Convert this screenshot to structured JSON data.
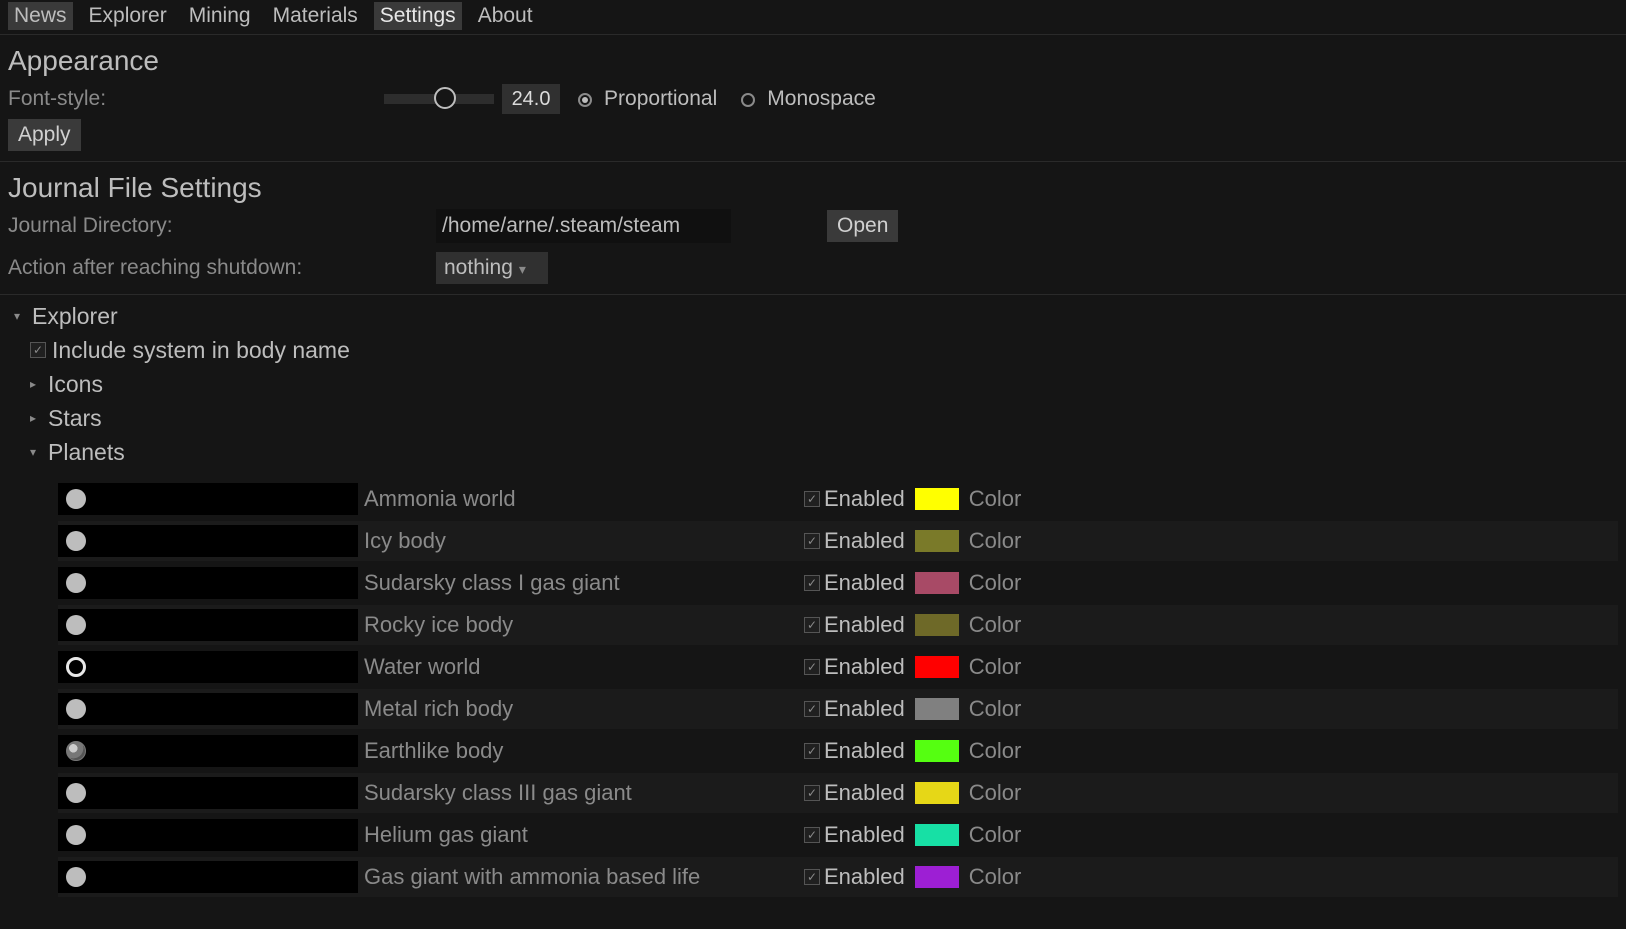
{
  "tabs": [
    "News",
    "Explorer",
    "Mining",
    "Materials",
    "Settings",
    "About"
  ],
  "active_tab": "Settings",
  "appearance": {
    "title": "Appearance",
    "font_style_label": "Font-style:",
    "font_size": "24.0",
    "prop_label": "Proportional",
    "mono_label": "Monospace",
    "apply_label": "Apply"
  },
  "journal": {
    "title": "Journal File Settings",
    "dir_label": "Journal Directory:",
    "dir_value": "/home/arne/.steam/steam",
    "open_label": "Open",
    "action_label": "Action after reaching shutdown:",
    "action_value": "nothing"
  },
  "explorer": {
    "title": "Explorer",
    "include_label": "Include system in body name",
    "icons_label": "Icons",
    "stars_label": "Stars",
    "planets_label": "Planets"
  },
  "enabled_label": "Enabled",
  "color_label": "Color",
  "planets": [
    {
      "name": "Ammonia world",
      "color": "#ffff00",
      "icon": "dot"
    },
    {
      "name": "Icy body",
      "color": "#7a7a29",
      "icon": "dot"
    },
    {
      "name": "Sudarsky class I gas giant",
      "color": "#a84a66",
      "icon": "dot"
    },
    {
      "name": "Rocky ice body",
      "color": "#6e6928",
      "icon": "dot"
    },
    {
      "name": "Water world",
      "color": "#ff0000",
      "icon": "ring"
    },
    {
      "name": "Metal rich body",
      "color": "#808080",
      "icon": "dot"
    },
    {
      "name": "Earthlike body",
      "color": "#55ff11",
      "icon": "earth"
    },
    {
      "name": "Sudarsky class III gas giant",
      "color": "#e6d717",
      "icon": "dot"
    },
    {
      "name": "Helium gas giant",
      "color": "#17e0a5",
      "icon": "dot"
    },
    {
      "name": "Gas giant with ammonia based life",
      "color": "#9d1fd4",
      "icon": "dot"
    }
  ]
}
